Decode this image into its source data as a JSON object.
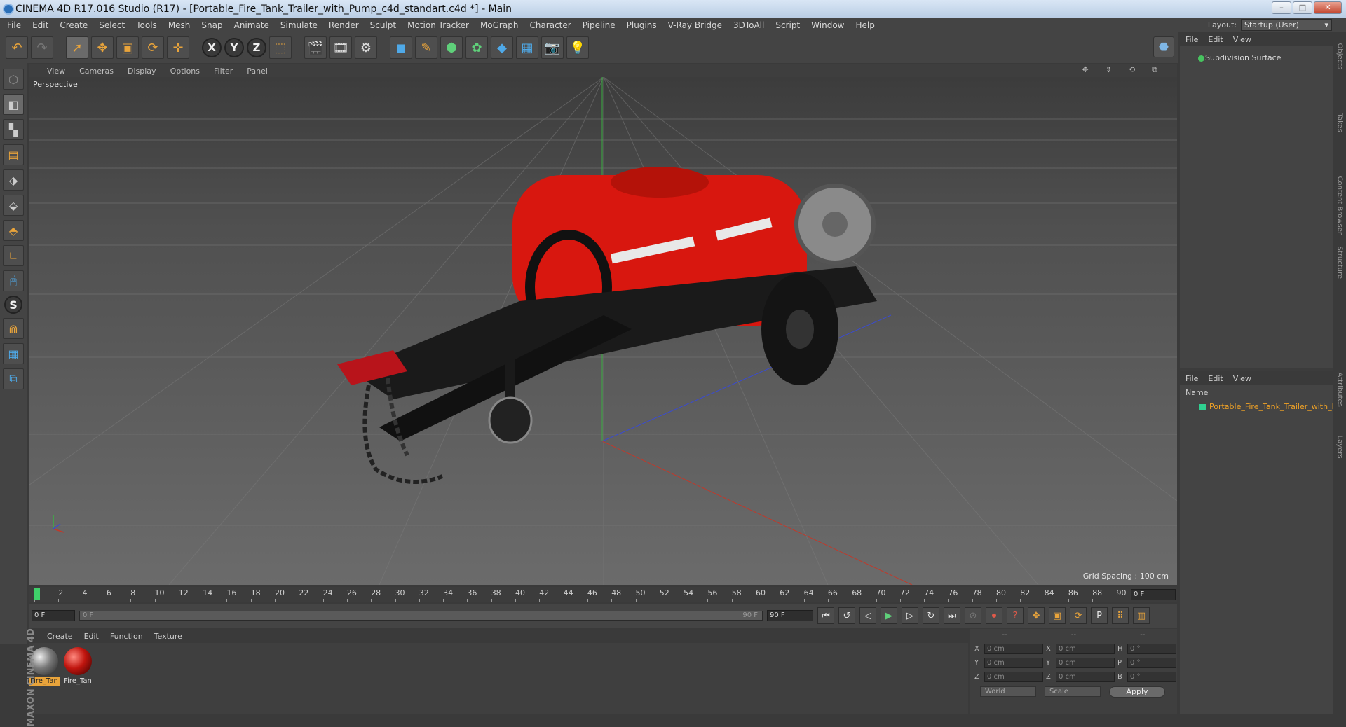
{
  "window": {
    "title": "CINEMA 4D R17.016 Studio (R17) - [Portable_Fire_Tank_Trailer_with_Pump_c4d_standart.c4d *] - Main",
    "minimize": "–",
    "maximize": "□",
    "close": "✕"
  },
  "menu": [
    "File",
    "Edit",
    "Create",
    "Select",
    "Tools",
    "Mesh",
    "Snap",
    "Animate",
    "Simulate",
    "Render",
    "Sculpt",
    "Motion Tracker",
    "MoGraph",
    "Character",
    "Pipeline",
    "Plugins",
    "V-Ray Bridge",
    "3DToAll",
    "Script",
    "Window",
    "Help"
  ],
  "layout": {
    "label": "Layout:",
    "value": "Startup (User)"
  },
  "viewport": {
    "menu": [
      "View",
      "Cameras",
      "Display",
      "Options",
      "Filter",
      "Panel"
    ],
    "label": "Perspective",
    "grid_spacing": "Grid Spacing : 100 cm"
  },
  "timeline": {
    "ticks": [
      "0",
      "2",
      "4",
      "6",
      "8",
      "10",
      "12",
      "14",
      "16",
      "18",
      "20",
      "22",
      "24",
      "26",
      "28",
      "30",
      "32",
      "34",
      "36",
      "38",
      "40",
      "42",
      "44",
      "46",
      "48",
      "50",
      "52",
      "54",
      "56",
      "58",
      "60",
      "62",
      "64",
      "66",
      "68",
      "70",
      "72",
      "74",
      "76",
      "78",
      "80",
      "82",
      "84",
      "86",
      "88",
      "90"
    ],
    "end_frame": "0 F"
  },
  "playback": {
    "current": "0 F",
    "slider_start": "0 F",
    "slider_end": "90 F",
    "max": "90 F"
  },
  "materials": {
    "menu": [
      "Create",
      "Edit",
      "Function",
      "Texture"
    ],
    "items": [
      {
        "name": "Fire_Tan"
      },
      {
        "name": "Fire_Tan"
      }
    ]
  },
  "coords": {
    "headers": [
      "--",
      "--",
      "--"
    ],
    "rows": [
      {
        "a": "X",
        "v1": "0 cm",
        "b": "X",
        "v2": "0 cm",
        "c": "H",
        "v3": "0 °"
      },
      {
        "a": "Y",
        "v1": "0 cm",
        "b": "Y",
        "v2": "0 cm",
        "c": "P",
        "v3": "0 °"
      },
      {
        "a": "Z",
        "v1": "0 cm",
        "b": "Z",
        "v2": "0 cm",
        "c": "B",
        "v3": "0 °"
      }
    ],
    "world": "World",
    "scale": "Scale",
    "apply": "Apply"
  },
  "objects": {
    "menu": [
      "File",
      "Edit",
      "View"
    ],
    "items": [
      "Subdivision Surface"
    ]
  },
  "layers": {
    "menu": [
      "File",
      "Edit",
      "View"
    ],
    "column": "Name",
    "items": [
      "Portable_Fire_Tank_Trailer_with_Pump"
    ]
  },
  "sidetabs": [
    "Objects",
    "Takes",
    "Content Browser",
    "Structure",
    "Attributes",
    "Layers"
  ],
  "brand": "MAXON CINEMA 4D",
  "accent_color": "#e9a43b"
}
